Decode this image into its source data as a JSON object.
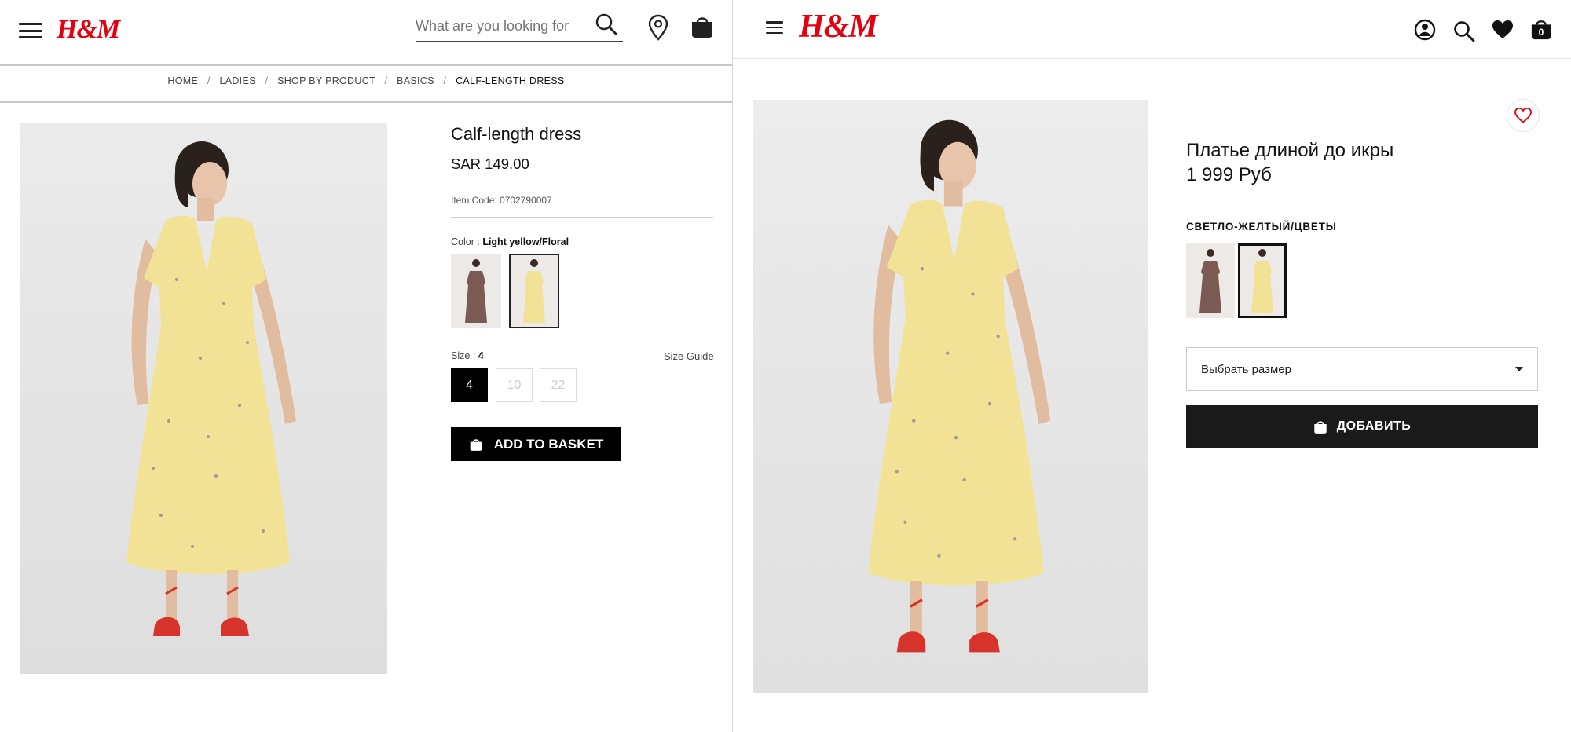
{
  "left": {
    "logo": "H&M",
    "search": {
      "placeholder": "What are you looking for"
    },
    "breadcrumb": [
      {
        "label": "HOME"
      },
      {
        "label": "LADIES"
      },
      {
        "label": "SHOP BY PRODUCT"
      },
      {
        "label": "BASICS"
      },
      {
        "label": "CALF-LENGTH DRESS"
      }
    ],
    "breadcrumb_sep": "/",
    "product": {
      "title": "Calf-length dress",
      "price": "SAR 149.00",
      "item_code": "Item Code: 0702790007",
      "color_label": "Color :",
      "color_value": "Light yellow/Floral",
      "size_label": "Size :",
      "size_value": "4",
      "size_guide": "Size Guide",
      "sizes": [
        "4",
        "10",
        "22"
      ],
      "add_to_basket": "ADD TO BASKET"
    }
  },
  "right": {
    "logo": "H&M",
    "basket_count": "0",
    "product": {
      "title": "Платье длиной до икры",
      "price": "1 999 Руб",
      "color_value": "СВЕТЛО-ЖЕЛТЫЙ/ЦВЕТЫ",
      "size_select": "Выбрать размер",
      "add_button": "ДОБАВИТЬ"
    }
  },
  "colors": {
    "brand_red": "#e50010",
    "dress_yellow": "#f2e295",
    "dress_brown": "#7a5a52",
    "button_dark": "#1a1a1a"
  }
}
